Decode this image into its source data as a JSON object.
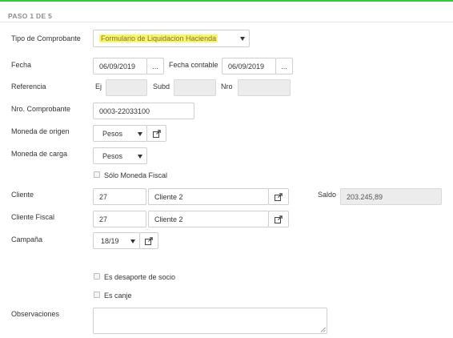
{
  "step": {
    "title": "PASO 1 DE 5"
  },
  "colors": {
    "accent_line": "#2ecc40",
    "highlight": "#f7f76a"
  },
  "labels": {
    "tipo": "Tipo de Comprobante",
    "fecha": "Fecha",
    "fecha_contable": "Fecha contable",
    "referencia": "Referencia",
    "ej": "Ej",
    "subd": "Subd",
    "nro": "Nro",
    "nro_comprobante": "Nro. Comprobante",
    "moneda_origen": "Moneda de origen",
    "moneda_carga": "Moneda de carga",
    "solo_moneda_fiscal": "Sólo Moneda Fiscal",
    "cliente": "Cliente",
    "saldo": "Saldo",
    "cliente_fiscal": "Cliente Fiscal",
    "campana": "Campaña",
    "desaporte": "Es desaporte de socio",
    "canje": "Es canje",
    "observaciones": "Observaciones"
  },
  "fields": {
    "tipo_comprobante": "Formulario de Liquidacion Hacienda",
    "fecha": "06/09/2019",
    "fecha_contable": "06/09/2019",
    "date_button": "...",
    "referencia_ej": "",
    "referencia_subd": "",
    "referencia_nro": "",
    "nro_comprobante": "0003-22033100",
    "moneda_origen": "Pesos",
    "moneda_carga": "Pesos",
    "cliente_codigo": "27",
    "cliente_nombre": "Cliente 2",
    "saldo": "203.245,89",
    "cliente_fiscal_codigo": "27",
    "cliente_fiscal_nombre": "Cliente 2",
    "campana": "18/19",
    "observaciones": ""
  },
  "icons": {
    "external_link": "external-link-icon",
    "dropdown": "caret-down-icon",
    "checkbox": "checkbox-icon"
  }
}
